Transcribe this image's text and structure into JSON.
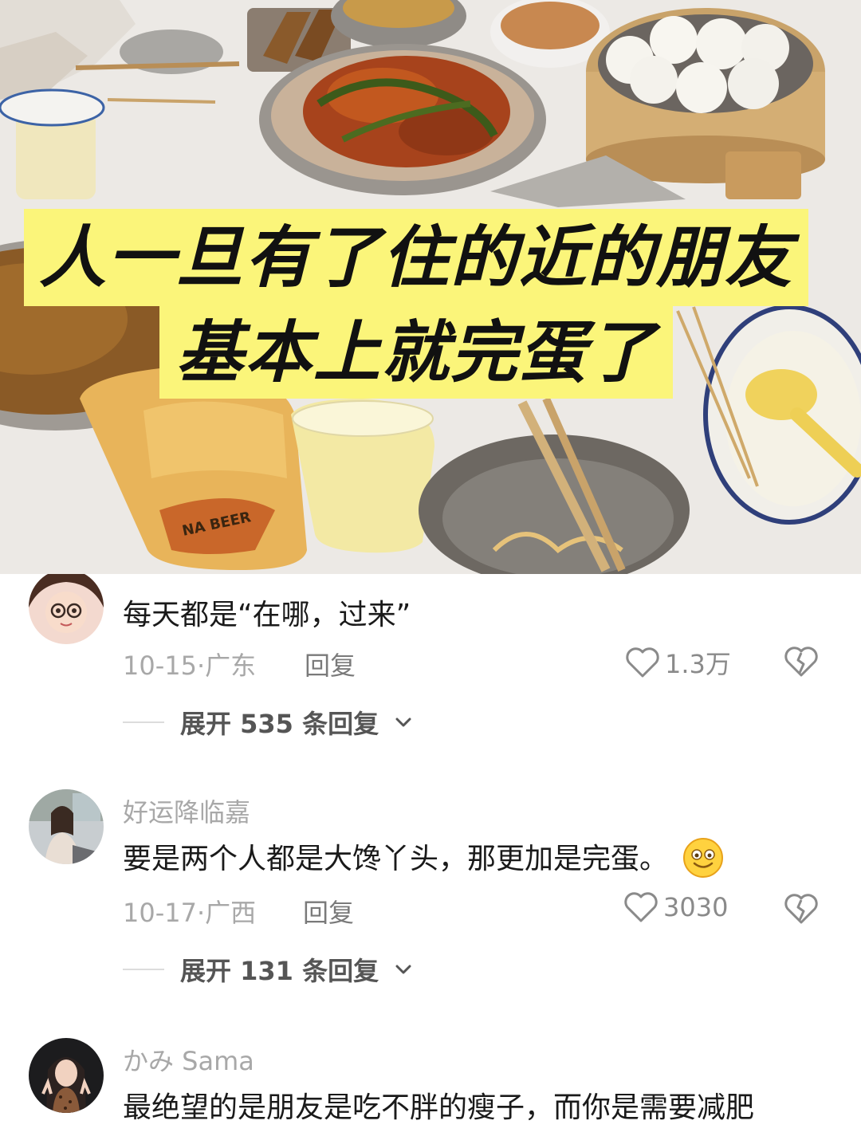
{
  "header": {
    "caption_line1": "人一旦有了住的近的朋友",
    "caption_line2": "基本上就完蛋了",
    "cup_print": "NA BEER"
  },
  "comments": [
    {
      "username": "",
      "text": "每天都是“在哪，过来”",
      "date_location": "10-15·广东",
      "reply_label": "回复",
      "likes": "1.3万",
      "expand_label": "展开 535 条回复"
    },
    {
      "username": "好运降临嘉",
      "text": "要是两个人都是大馋丫头，那更加是完蛋。",
      "date_location": "10-17·广西",
      "reply_label": "回复",
      "likes": "3030",
      "expand_label": "展开 131 条回复"
    },
    {
      "username": "かみ Sama",
      "text": "最绝望的是朋友是吃不胖的瘦子，而你是需要减肥"
    }
  ],
  "icons": {
    "like": "heart-outline-icon",
    "dislike": "broken-heart-icon",
    "expand": "chevron-down-icon",
    "emoji": "smiling-face-emoji"
  },
  "colors": {
    "caption_bg": "#fbf57a",
    "meta_text": "#a8a8a8",
    "body_text": "#1a1a1a"
  }
}
